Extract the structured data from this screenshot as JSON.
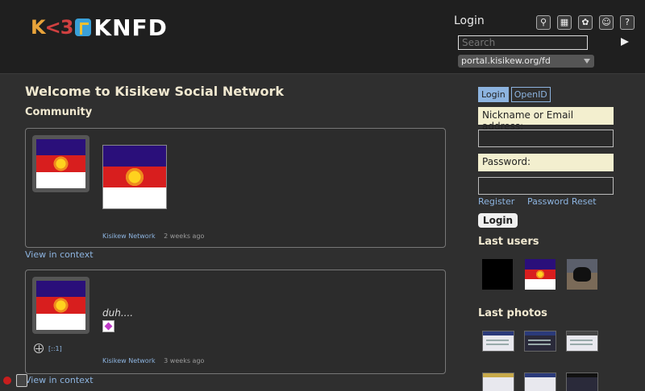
{
  "header": {
    "logo_mark": "K<3",
    "brand": "KNFD",
    "login_link": "Login",
    "icons": [
      "search-icon",
      "contacts-icon",
      "settings-icon",
      "community-icon",
      "help-icon"
    ],
    "help_glyph": "?",
    "search_placeholder": "Search",
    "portal_selected": "portal.kisikew.org/fd"
  },
  "main": {
    "title": "Welcome to Kisikew Social Network",
    "section": "Community",
    "posts": [
      {
        "author": "Kisikew Network",
        "time": "2 weeks ago",
        "view_link": "View in context"
      },
      {
        "text": "duh....",
        "author": "Kisikew Network",
        "time": "3 weeks ago",
        "view_link": "View in context",
        "tool_label": "[::1]"
      }
    ]
  },
  "aside": {
    "tabs": [
      "Login",
      "OpenID"
    ],
    "nickname_label": "Nickname or Email address:",
    "password_label": "Password:",
    "register": "Register",
    "password_reset": "Password Reset",
    "login_button": "Login",
    "last_users_title": "Last users",
    "last_photos_title": "Last photos"
  },
  "colors": {
    "link": "#8db4e0",
    "header_bg": "#1f1f1f",
    "page_bg": "#2f2f2f",
    "field_label_bg": "#f3efcf"
  }
}
